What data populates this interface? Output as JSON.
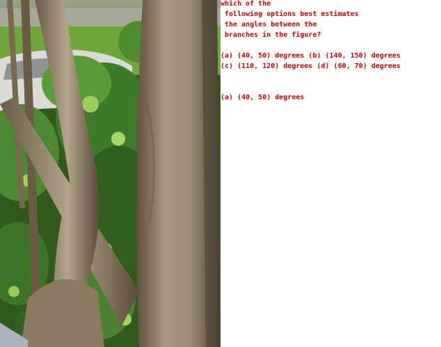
{
  "question": {
    "lines": [
      "which of the",
      " following options best estimates",
      " the angles between the",
      " branches in the figure?"
    ],
    "options": [
      "(a) (40, 50) degrees (b) (140, 150) degrees",
      "(c) (110, 120) degrees (d) (60, 70) degrees"
    ]
  },
  "answer": "(a) (40, 50) degrees",
  "colors": {
    "text": "#cc0000",
    "trunk": "#8a7a66",
    "foliage": "#3f7a2a",
    "lawn": "#6fa83a"
  }
}
